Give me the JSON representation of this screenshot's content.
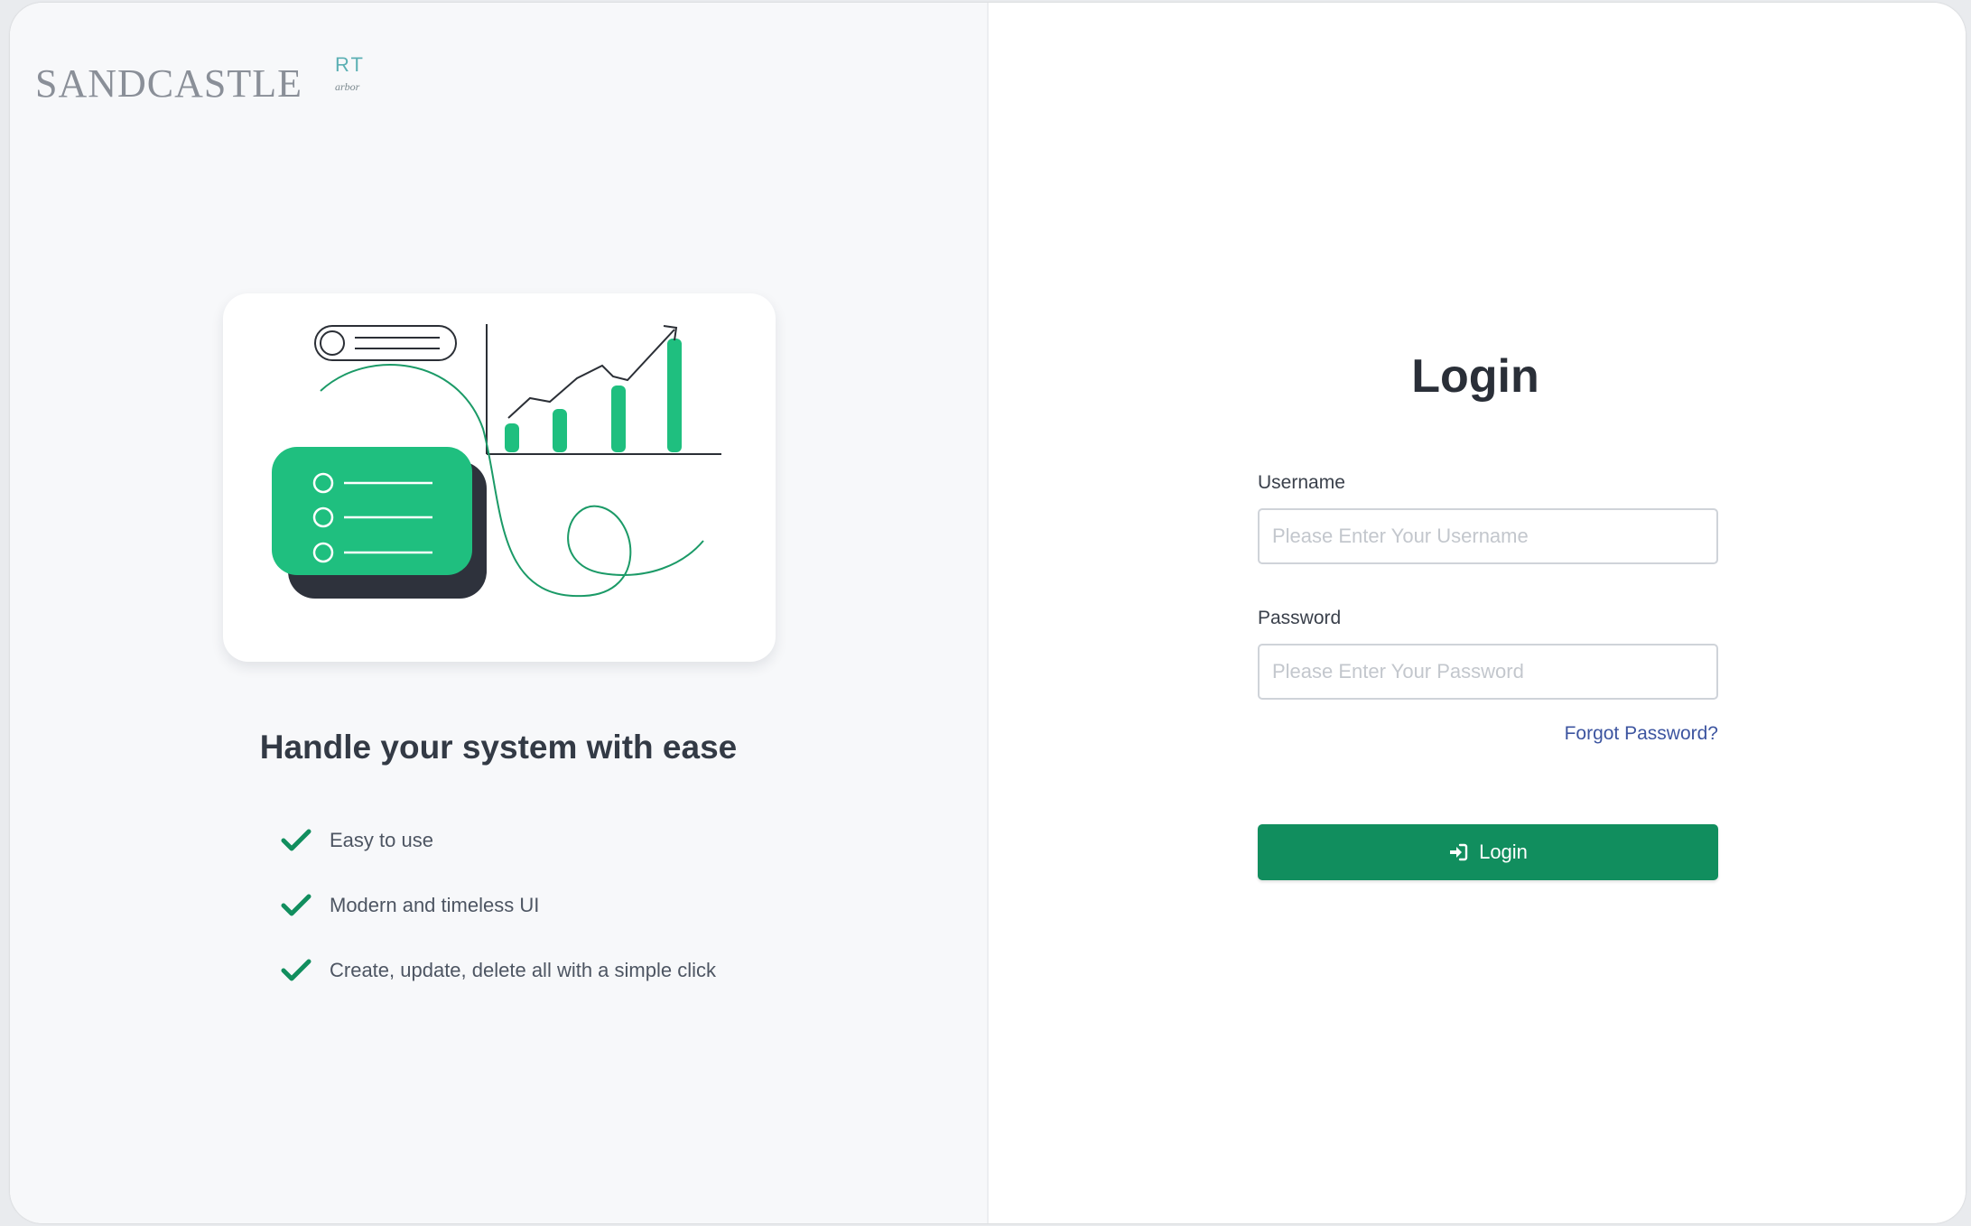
{
  "branding": {
    "name": "SANDCASTLE",
    "tag": "RT",
    "tag_sub": "arbor"
  },
  "left": {
    "illustration_icon": "dashboard-illustration",
    "tagline": "Handle your system with ease",
    "features": [
      {
        "icon": "check-icon",
        "label": "Easy to use"
      },
      {
        "icon": "check-icon",
        "label": "Modern and timeless UI"
      },
      {
        "icon": "check-icon",
        "label": "Create, update, delete all with a simple click"
      }
    ]
  },
  "login": {
    "title": "Login",
    "username": {
      "label": "Username",
      "value": "",
      "placeholder": "Please Enter Your Username"
    },
    "password": {
      "label": "Password",
      "value": "",
      "placeholder": "Please Enter Your Password"
    },
    "forgot_label": "Forgot Password?",
    "button_label": "Login",
    "button_icon": "sign-in-icon"
  },
  "colors": {
    "accent": "#118e5e",
    "illustration_green": "#1fbf7f",
    "link": "#3d55a0",
    "left_background": "#f7f8fa"
  }
}
